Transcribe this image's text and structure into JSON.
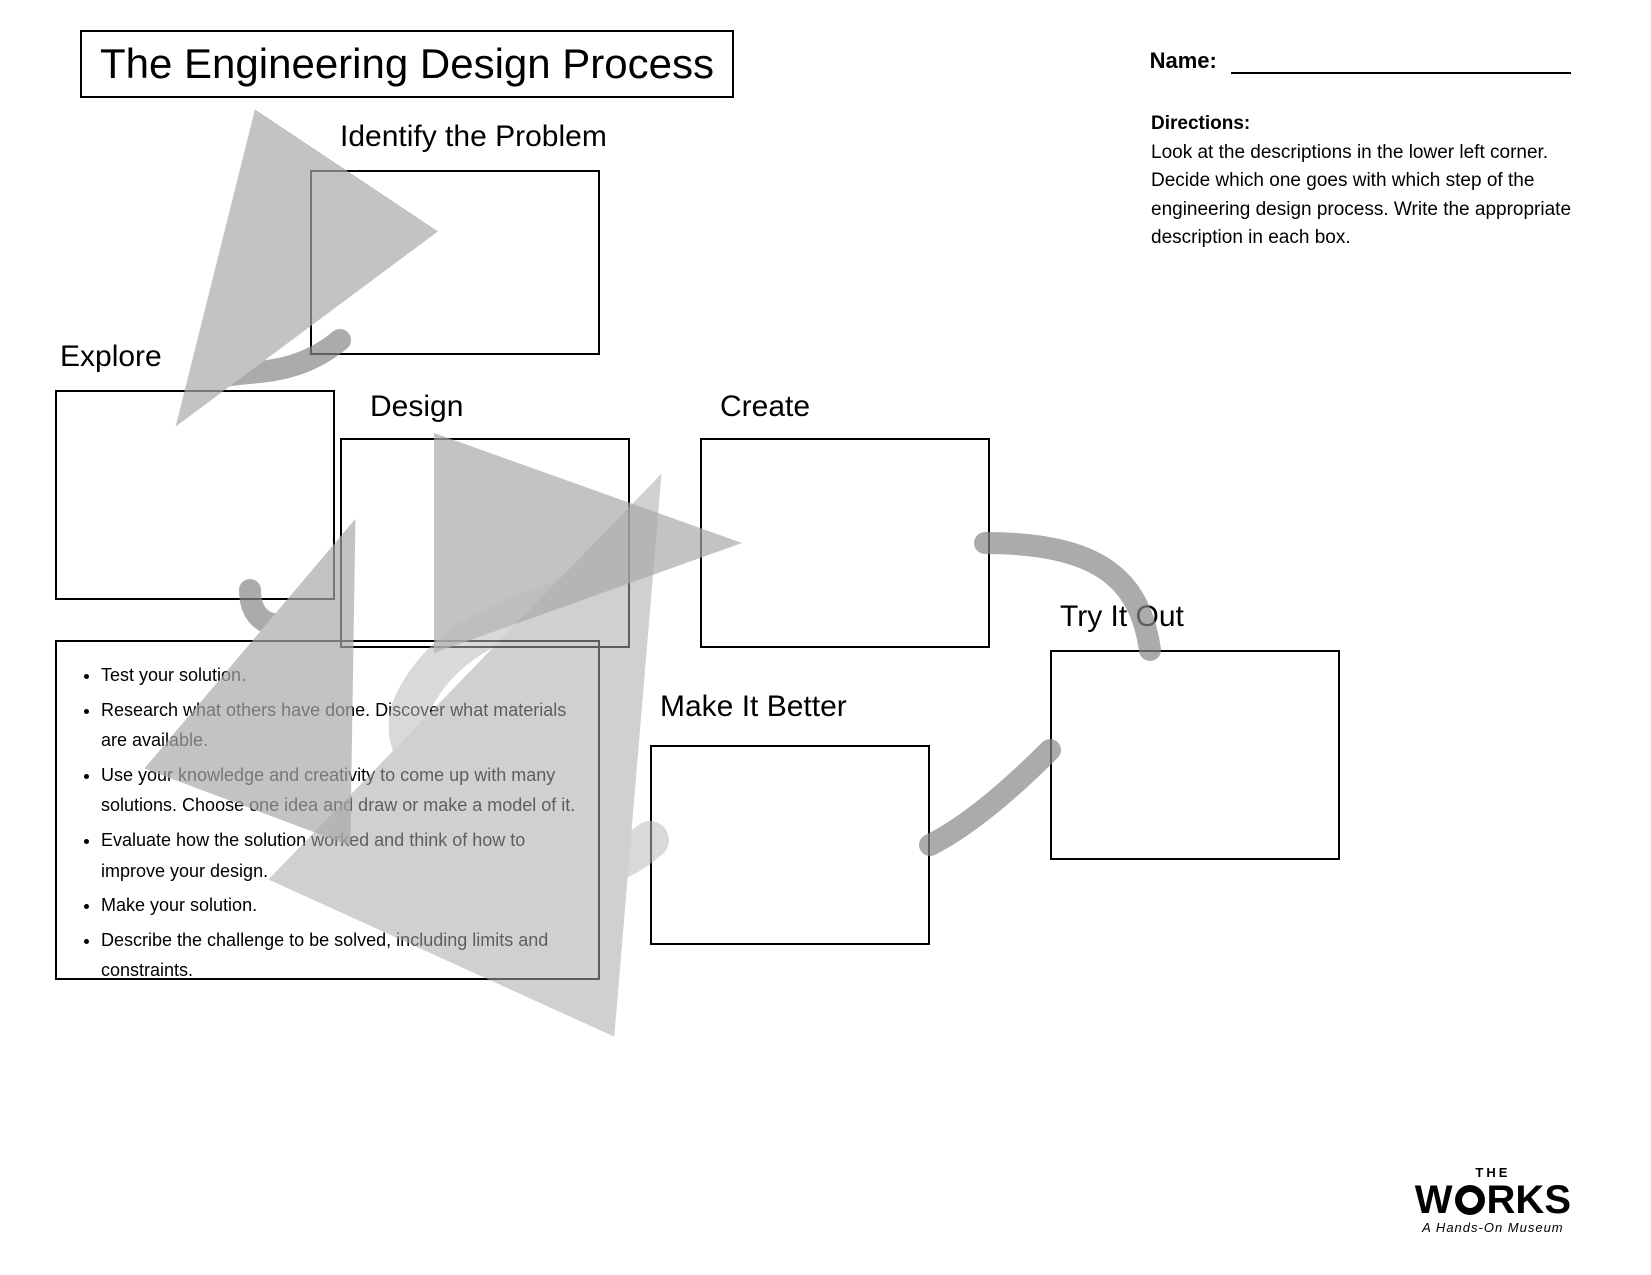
{
  "title": "The Engineering Design Process",
  "name_label": "Name:",
  "directions_title": "Directions:",
  "directions_text": "Look at the descriptions in the lower left corner. Decide which one goes with which step of the engineering design process.  Write the appropriate description in each box.",
  "steps": {
    "identify": "Identify the Problem",
    "explore": "Explore",
    "design": "Design",
    "create": "Create",
    "try_it_out": "Try It Out",
    "make_it_better": "Make It Better"
  },
  "bullets": [
    "Test your solution.",
    "Research what others have done.  Discover what materials are available.",
    "Use your knowledge and creativity to come up with many solutions.  Choose one idea and draw or make a model of it.",
    "Evaluate how the solution worked and think of how to improve your design.",
    "Make your solution.",
    "Describe the challenge to be solved, including limits and constraints."
  ],
  "logo": {
    "the": "THE",
    "works": "WORKS",
    "sub": "A Hands-On Museum"
  }
}
